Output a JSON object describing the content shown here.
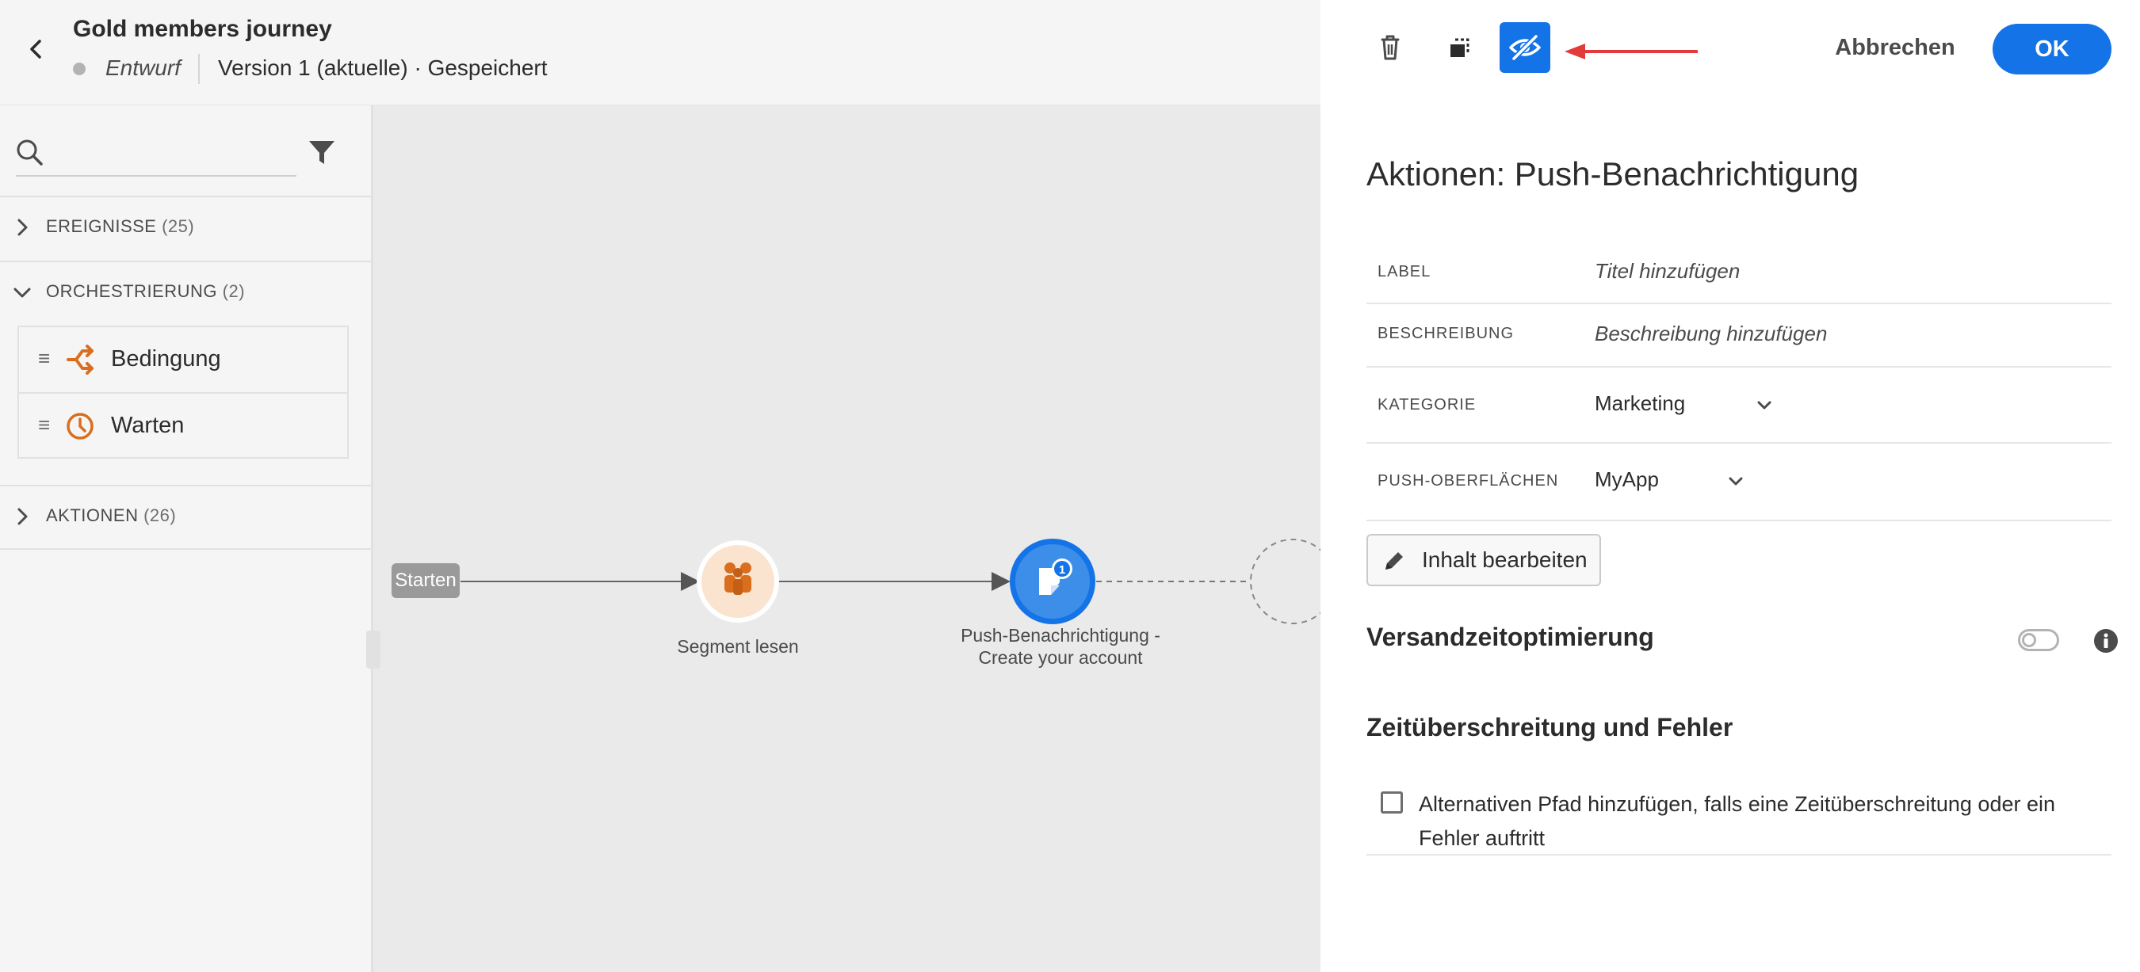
{
  "header": {
    "title": "Gold members journey",
    "status": "Entwurf",
    "version": "Version 1 (aktuelle) · Gespeichert"
  },
  "sidebar": {
    "search": {
      "value": "",
      "placeholder": ""
    },
    "sections": [
      {
        "label": "EREIGNISSE",
        "count": "(25)",
        "expanded": false
      },
      {
        "label": "ORCHESTRIERUNG",
        "count": "(2)",
        "expanded": true
      },
      {
        "label": "AKTIONEN",
        "count": "(26)",
        "expanded": false
      }
    ],
    "orchestration_items": [
      {
        "label": "Bedingung",
        "icon": "condition-icon"
      },
      {
        "label": "Warten",
        "icon": "clock-icon"
      }
    ]
  },
  "canvas": {
    "start_label": "Starten",
    "nodes": [
      {
        "label": "Segment lesen",
        "icon": "segment-icon"
      },
      {
        "label_line1": "Push-Benachrichtigung -",
        "label_line2": "Create your account",
        "icon": "push-notification-icon",
        "badge": "1"
      }
    ]
  },
  "panel": {
    "toolbar": {
      "delete_icon": "trash-icon",
      "duplicate_icon": "duplicate-icon",
      "hide_icon": "eye-off-icon",
      "cancel_label": "Abbrechen",
      "ok_label": "OK"
    },
    "title": "Aktionen: Push-Benachrichtigung",
    "properties": [
      {
        "key": "LABEL",
        "value": "Titel hinzufügen"
      },
      {
        "key": "BESCHREIBUNG",
        "value": "Beschreibung hinzufügen"
      },
      {
        "key": "KATEGORIE",
        "value": "Marketing"
      },
      {
        "key": "PUSH-OBERFLÄCHEN",
        "value": "MyApp"
      }
    ],
    "edit_content_label": "Inhalt bearbeiten",
    "send_time_optimization": {
      "title": "Versandzeitoptimierung",
      "enabled": false
    },
    "timeout_section": {
      "title": "Zeitüberschreitung und Fehler",
      "checkbox_label": "Alternativen Pfad hinzufügen, falls eine Zeitüberschreitung oder ein Fehler auftritt",
      "checked": false
    }
  },
  "colors": {
    "accent": "#1473e6",
    "orange": "#d96e1f",
    "annotation_arrow": "#e33a3a"
  }
}
